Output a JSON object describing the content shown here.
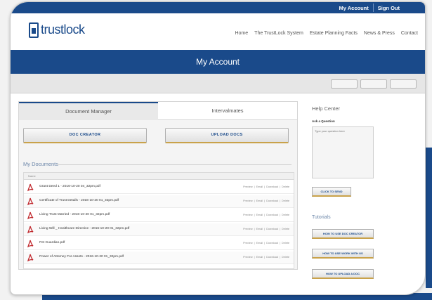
{
  "top_links": {
    "my_account": "My Account",
    "sign_out": "Sign Out"
  },
  "brand": {
    "name": "trustlock",
    "tagline": ""
  },
  "nav": [
    "Home",
    "The TrustLock System",
    "Estate Planning Facts",
    "News & Press",
    "Contact"
  ],
  "page_title": "My Account",
  "toolbar_buttons": [
    "",
    "",
    ""
  ],
  "tabs": {
    "active": "Document Manager",
    "inactive": "Intervalmates"
  },
  "buttons": {
    "doc_creator": "DOC CREATOR",
    "upload_docs": "UPLOAD DOCS"
  },
  "documents": {
    "title": "My Documents",
    "column_name": "Name",
    "actions": [
      "Preview",
      "Email",
      "Download",
      "Delete"
    ],
    "files": [
      "Grant Deed 1 - 2016-10-20 04_32pm.pdf",
      "Certificate of Trust Details - 2016-10-20 01_32pm.pdf",
      "Living Trust Married - 2016-10-20 01_32pm.pdf",
      "Living Will _ Healthcare Directive - 2016-10-20 01_32pm.pdf",
      "Pet Guardian.pdf",
      "Power of Attorney For Assets - 2016-10-20 01_32pm.pdf"
    ]
  },
  "help": {
    "title": "Help Center",
    "ask_label": "Ask a Question",
    "placeholder": "Type your question here",
    "send": "CLICK TO SEND"
  },
  "tutorials": {
    "title": "Tutorials",
    "items": [
      "HOW TO USE DOC CREATOR",
      "HOW TO USE WORK WITH US",
      "HOW TO UPLOAD A DOC"
    ]
  },
  "colors": {
    "primary": "#1a4a8a",
    "accent": "#c9a24a",
    "pdf": "#c0282d"
  }
}
